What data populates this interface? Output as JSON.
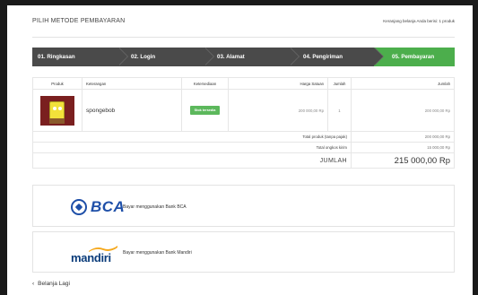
{
  "header": {
    "title": "PILIH METODE PEMBAYARAN",
    "cart_info": "Keranjang belanja Anda berisi: 1 produk"
  },
  "steps": [
    {
      "label": "01. Ringkasan",
      "active": false
    },
    {
      "label": "02. Login",
      "active": false
    },
    {
      "label": "03. Alamat",
      "active": false
    },
    {
      "label": "04. Pengiriman",
      "active": false
    },
    {
      "label": "05. Pembayaran",
      "active": true
    }
  ],
  "table": {
    "headers": {
      "produk": "Produk",
      "keterangan": "Keterangan",
      "ketersediaan": "Ketersediaan",
      "harga_satuan": "Harga Satuan",
      "jumlah_qty": "Jumlah",
      "jumlah": "Jumlah"
    },
    "item": {
      "image": "spongebob-product-image",
      "name": "spongebob",
      "availability": "Stok tersedia",
      "unit_price": "200 000,00 Rp",
      "quantity": "1",
      "total": "200 000,00 Rp"
    },
    "summary": {
      "products_label": "Total produk (tanpa pajak)",
      "products_value": "200 000,00 Rp",
      "shipping_label": "Total ongkos kirim",
      "shipping_value": "15 000,00 Rp",
      "total_label": "JUMLAH",
      "total_value": "215 000,00 Rp"
    }
  },
  "payment": {
    "bca": {
      "logo_text": "BCA",
      "label": "Bayar menggunakan Bank BCA"
    },
    "mandiri": {
      "logo_text": "mandiri",
      "label": "Bayar menggunakan Bank Mandiri"
    }
  },
  "back_link": "Belanja Lagi",
  "colors": {
    "accent": "#4cae4c",
    "step_bg": "#4a4a4a",
    "bca_blue": "#1e4fa8",
    "mandiri_blue": "#0b3c7a",
    "mandiri_gold": "#f5a81c"
  }
}
